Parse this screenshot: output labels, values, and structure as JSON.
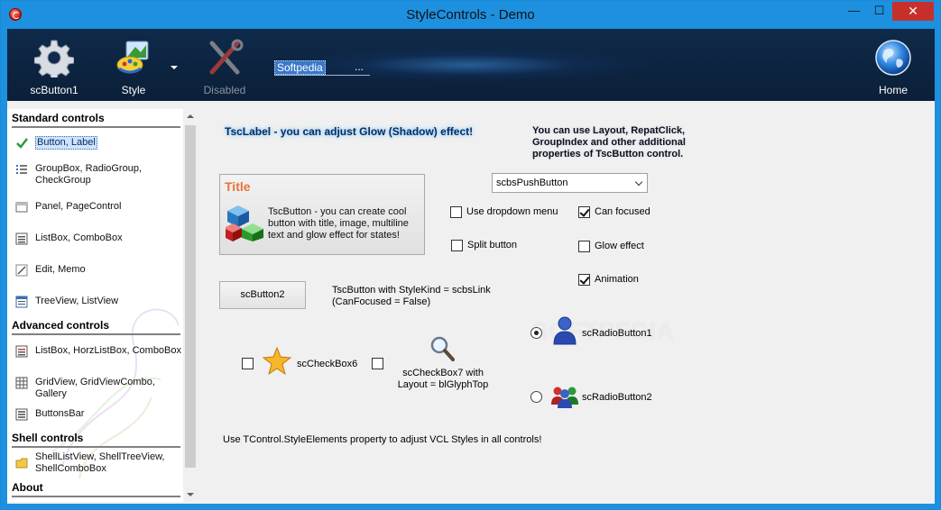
{
  "window": {
    "title": "StyleControls - Demo",
    "min_glyph": "—",
    "max_glyph": "☐",
    "close_glyph": "✕"
  },
  "toolbar": {
    "buttons": [
      {
        "label": "scButton1",
        "icon": "gear-icon"
      },
      {
        "label": "Style",
        "icon": "paint-palette-icon"
      },
      {
        "label": "Disabled",
        "icon": "tools-icon"
      },
      {
        "label": "Home",
        "icon": "globe-icon"
      }
    ],
    "edit_value": "Softpedia",
    "edit_ellipsis": "..."
  },
  "sidebar": {
    "groups": [
      {
        "title": "Standard controls"
      },
      {
        "title": "Advanced controls"
      },
      {
        "title": "Shell controls"
      },
      {
        "title": "About"
      }
    ],
    "items": [
      {
        "label": "Button, Label",
        "icon": "checkmark-icon"
      },
      {
        "label": "GroupBox, RadioGroup, CheckGroup",
        "icon": "list-icon"
      },
      {
        "label": "Panel, PageControl",
        "icon": "panel-icon"
      },
      {
        "label": "ListBox, ComboBox",
        "icon": "listbox-icon"
      },
      {
        "label": "Edit, Memo",
        "icon": "edit-icon"
      },
      {
        "label": "TreeView, ListView",
        "icon": "treeview-icon"
      },
      {
        "label": "ListBox, HorzListBox, ComboBox",
        "icon": "listbox-icon"
      },
      {
        "label": "GridView, GridViewCombo, Gallery",
        "icon": "grid-icon"
      },
      {
        "label": "ButtonsBar",
        "icon": "buttonsbar-icon"
      },
      {
        "label": "ShellListView, ShellTreeView, ShellComboBox",
        "icon": "folder-icon"
      }
    ]
  },
  "main": {
    "glow_label": "TscLabel - you can adjust Glow (Shadow) effect!",
    "glow_note": "You can use Layout,  RepatClick, GroupIndex and other additional properties of TscButton control.",
    "big_button": {
      "title": "Title",
      "text": "TscButton - you can create cool button with title, image, multiline text and glow effect for states!"
    },
    "std_button": "scButton2",
    "link_note_line1": "TscButton with StyleKind = scbsLink",
    "link_note_line2": "(CanFocused = False)",
    "combo_value": "scbsPushButton",
    "checks": {
      "use_dropdown_menu": {
        "label": "Use dropdown menu",
        "checked": false
      },
      "split_button": {
        "label": "Split button",
        "checked": false
      },
      "can_focused": {
        "label": "Can focused",
        "checked": true
      },
      "glow_effect": {
        "label": "Glow effect",
        "checked": false
      },
      "animation": {
        "label": "Animation",
        "checked": true
      },
      "checkbox6": {
        "label": "scCheckBox6",
        "checked": false
      },
      "checkbox7": {
        "label_line1": "scCheckBox7 with",
        "label_line2": "Layout = blGlyphTop",
        "checked": false
      }
    },
    "radios": {
      "radio1": {
        "label": "scRadioButton1",
        "selected": true
      },
      "radio2": {
        "label": "scRadioButton2",
        "selected": false
      }
    },
    "footer_note": "Use TControl.StyleElements property to adjust VCL Styles  in all controls!",
    "watermark": "SOFTPEDIA"
  }
}
